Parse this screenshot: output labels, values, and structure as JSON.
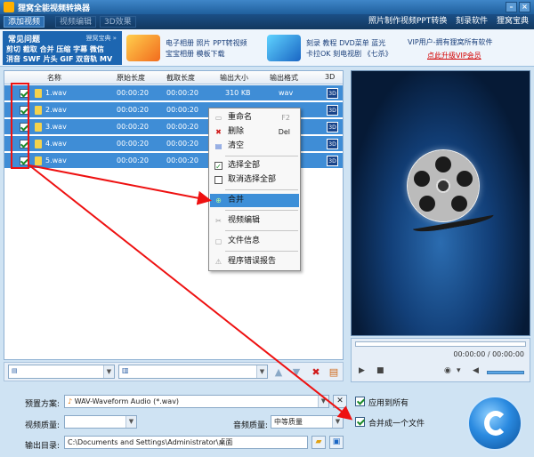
{
  "window": {
    "title": "狸窝全能视频转换器"
  },
  "menubar": {
    "tabs": [
      "添加视频",
      "视频编辑",
      "3D效果"
    ],
    "links": [
      "照片制作视频",
      "PPT转换",
      "刻录软件",
      "狸窝宝典"
    ]
  },
  "ad": {
    "faq_title": "常见问题",
    "faq_brand": "狸窝宝典 »",
    "faq_line1": "剪切 截取 合并 压缩 字幕 微信",
    "faq_line2": "消音 SWF 片头 GIF 双音轨 MV",
    "promo1_line1": "电子相册 照片 PPT转视频",
    "promo1_line2": "宝宝相册 模板下载",
    "promo2_line1": "刻录 教程 DVD菜单 蓝光",
    "promo2_line2": "卡拉OK 刻电视剧 《七杀》",
    "vip_line": "VIP用户-拥有狸窝所有软件",
    "vip_link": "点此升级VIP会员"
  },
  "table": {
    "columns": [
      "名称",
      "原始长度",
      "截取长度",
      "输出大小",
      "输出格式",
      "3D"
    ],
    "rows": [
      {
        "name": "1.wav",
        "orig": "00:00:20",
        "cut": "00:00:20",
        "size": "310 KB",
        "format": "wav",
        "badge": "3D"
      },
      {
        "name": "2.wav",
        "orig": "00:00:20",
        "cut": "00:00:20",
        "size": "",
        "format": "",
        "badge": "3D"
      },
      {
        "name": "3.wav",
        "orig": "00:00:20",
        "cut": "00:00:20",
        "size": "",
        "format": "",
        "badge": "3D"
      },
      {
        "name": "4.wav",
        "orig": "00:00:20",
        "cut": "00:00:20",
        "size": "",
        "format": "",
        "badge": "3D"
      },
      {
        "name": "5.wav",
        "orig": "00:00:20",
        "cut": "00:00:20",
        "size": "",
        "format": "",
        "badge": "3D"
      }
    ]
  },
  "context_menu": {
    "rename": "重命名",
    "rename_key": "F2",
    "delete": "删除",
    "delete_key": "Del",
    "clear": "清空",
    "select_all": "选择全部",
    "deselect_all": "取消选择全部",
    "merge": "合并",
    "video_edit": "视频编辑",
    "file_info": "文件信息",
    "error_report": "程序错误报告"
  },
  "preview": {
    "time": "00:00:00 / 00:00:00"
  },
  "settings": {
    "preset_label": "预置方案:",
    "preset_value": "WAV-Waveform Audio (*.wav)",
    "apply_all": "应用到所有",
    "video_quality_label": "视频质量:",
    "video_quality_value": "",
    "audio_quality_label": "音频质量:",
    "audio_quality_value": "中等质量",
    "merge_one": "合并成一个文件",
    "output_label": "输出目录:",
    "output_value": "C:\\Documents and Settings\\Administrator\\桌面"
  }
}
